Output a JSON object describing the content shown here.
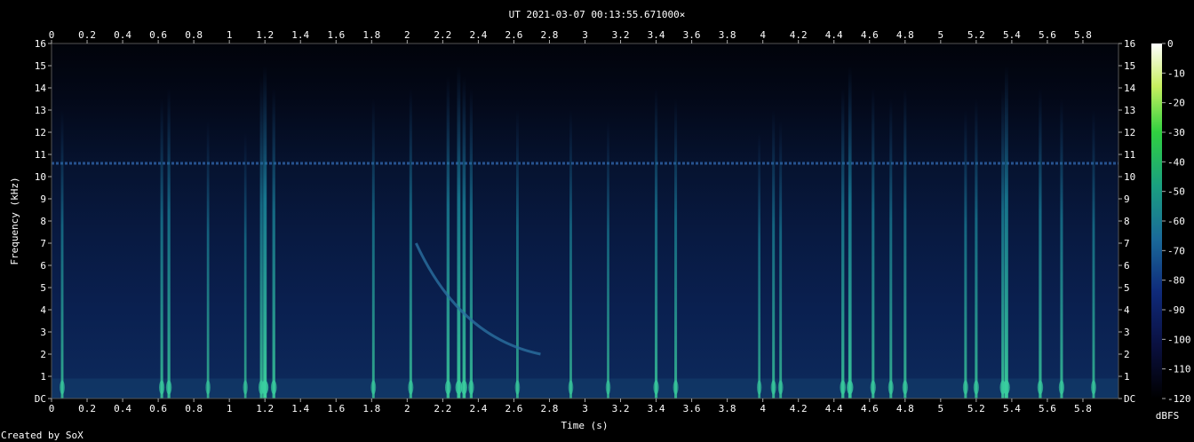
{
  "chart_data": {
    "type": "heatmap",
    "title": "UT 2021-03-07 00:13:55.671000×",
    "xlabel": "Time (s)",
    "ylabel": "Frequency (kHz)",
    "colorbar_label": "dBFS",
    "footer": "Created by SoX",
    "xlim": [
      0,
      6.0
    ],
    "ylim": [
      0,
      16
    ],
    "x_ticks": [
      "0",
      "0.2",
      "0.4",
      "0.6",
      "0.8",
      "1",
      "1.2",
      "1.4",
      "1.6",
      "1.8",
      "2",
      "2.2",
      "2.4",
      "2.6",
      "2.8",
      "3",
      "3.2",
      "3.4",
      "3.6",
      "3.8",
      "4",
      "4.2",
      "4.4",
      "4.6",
      "4.8",
      "5",
      "5.2",
      "5.4",
      "5.6",
      "5.8"
    ],
    "y_ticks": [
      "DC",
      "1",
      "2",
      "3",
      "4",
      "5",
      "6",
      "7",
      "8",
      "9",
      "10",
      "11",
      "12",
      "13",
      "14",
      "15",
      "16"
    ],
    "colorbar_ticks": [
      "0",
      "-10",
      "-20",
      "-30",
      "-40",
      "-50",
      "-60",
      "-70",
      "-80",
      "-90",
      "-100",
      "-110",
      "-120"
    ],
    "colorbar_range": [
      -120,
      0
    ],
    "background_color": "#000000",
    "noise_floor_color": "#0a1f4a",
    "constant_tone_khz": 10.6,
    "impulses": [
      {
        "t": 0.06,
        "top_khz": 13.0,
        "dbfs": -92
      },
      {
        "t": 0.62,
        "top_khz": 13.5,
        "dbfs": -88
      },
      {
        "t": 0.66,
        "top_khz": 14.0,
        "dbfs": -86
      },
      {
        "t": 0.88,
        "top_khz": 12.5,
        "dbfs": -95
      },
      {
        "t": 1.09,
        "top_khz": 12.0,
        "dbfs": -96
      },
      {
        "t": 1.18,
        "top_khz": 14.5,
        "dbfs": -86
      },
      {
        "t": 1.2,
        "top_khz": 15.0,
        "dbfs": -70
      },
      {
        "t": 1.25,
        "top_khz": 14.0,
        "dbfs": -84
      },
      {
        "t": 1.81,
        "top_khz": 13.5,
        "dbfs": -92
      },
      {
        "t": 2.02,
        "top_khz": 14.0,
        "dbfs": -90
      },
      {
        "t": 2.23,
        "top_khz": 14.5,
        "dbfs": -82
      },
      {
        "t": 2.29,
        "top_khz": 15.0,
        "dbfs": -74
      },
      {
        "t": 2.32,
        "top_khz": 14.5,
        "dbfs": -78
      },
      {
        "t": 2.36,
        "top_khz": 14.0,
        "dbfs": -86
      },
      {
        "t": 2.62,
        "top_khz": 13.0,
        "dbfs": -94
      },
      {
        "t": 2.92,
        "top_khz": 13.0,
        "dbfs": -94
      },
      {
        "t": 3.13,
        "top_khz": 12.5,
        "dbfs": -95
      },
      {
        "t": 3.4,
        "top_khz": 14.0,
        "dbfs": -88
      },
      {
        "t": 3.51,
        "top_khz": 13.5,
        "dbfs": -90
      },
      {
        "t": 3.98,
        "top_khz": 12.0,
        "dbfs": -96
      },
      {
        "t": 4.06,
        "top_khz": 13.0,
        "dbfs": -90
      },
      {
        "t": 4.1,
        "top_khz": 12.5,
        "dbfs": -92
      },
      {
        "t": 4.45,
        "top_khz": 14.0,
        "dbfs": -84
      },
      {
        "t": 4.49,
        "top_khz": 15.0,
        "dbfs": -76
      },
      {
        "t": 4.62,
        "top_khz": 14.0,
        "dbfs": -88
      },
      {
        "t": 4.72,
        "top_khz": 13.5,
        "dbfs": -90
      },
      {
        "t": 4.8,
        "top_khz": 14.0,
        "dbfs": -88
      },
      {
        "t": 5.14,
        "top_khz": 13.0,
        "dbfs": -90
      },
      {
        "t": 5.2,
        "top_khz": 13.5,
        "dbfs": -88
      },
      {
        "t": 5.35,
        "top_khz": 14.0,
        "dbfs": -82
      },
      {
        "t": 5.37,
        "top_khz": 15.0,
        "dbfs": -74
      },
      {
        "t": 5.56,
        "top_khz": 14.0,
        "dbfs": -86
      },
      {
        "t": 5.68,
        "top_khz": 13.5,
        "dbfs": -88
      },
      {
        "t": 5.86,
        "top_khz": 13.0,
        "dbfs": -92
      }
    ],
    "sweep": {
      "t_start": 2.05,
      "f_start_khz": 7.0,
      "t_end": 2.75,
      "f_end_khz": 2.0
    }
  }
}
